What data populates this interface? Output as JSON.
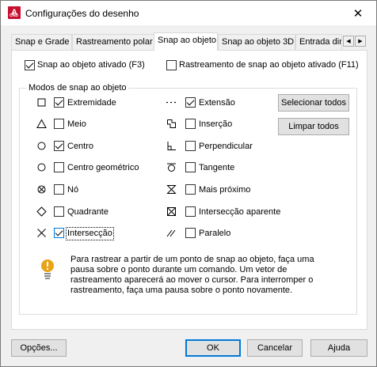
{
  "window": {
    "title": "Configurações do desenho",
    "app_icon_letter": "A",
    "app_icon_caption": "CAD",
    "close_glyph": "✕"
  },
  "tabs": [
    {
      "label": "Snap e Grade",
      "active": false
    },
    {
      "label": "Rastreamento polar",
      "active": false
    },
    {
      "label": "Snap ao objeto",
      "active": true
    },
    {
      "label": "Snap ao objeto 3D",
      "active": false
    },
    {
      "label": "Entrada din",
      "active": false
    }
  ],
  "tab_scroll": {
    "left_glyph": "◀",
    "right_glyph": "▶"
  },
  "top_options": {
    "snap_on": {
      "label": "Snap ao objeto ativado (F3)",
      "checked": true
    },
    "tracking_on": {
      "label": "Rastreamento de snap ao objeto ativado (F11)",
      "checked": false
    }
  },
  "modes_group": {
    "title": "Modos de snap ao objeto",
    "left": [
      {
        "icon": "endpoint-square-icon",
        "label": "Extremidade",
        "checked": true
      },
      {
        "icon": "midpoint-triangle-icon",
        "label": "Meio",
        "checked": false
      },
      {
        "icon": "center-circle-icon",
        "label": "Centro",
        "checked": true
      },
      {
        "icon": "geometric-center-icon",
        "label": "Centro geométrico",
        "checked": false
      },
      {
        "icon": "node-icon",
        "label": "Nó",
        "checked": false
      },
      {
        "icon": "quadrant-diamond-icon",
        "label": "Quadrante",
        "checked": false
      },
      {
        "icon": "intersection-x-icon",
        "label": "Intersecção",
        "checked": true
      }
    ],
    "right": [
      {
        "icon": "extension-icon",
        "label": "Extensão",
        "checked": true
      },
      {
        "icon": "insertion-icon",
        "label": "Inserção",
        "checked": false
      },
      {
        "icon": "perpendicular-icon",
        "label": "Perpendicular",
        "checked": false
      },
      {
        "icon": "tangent-icon",
        "label": "Tangente",
        "checked": false
      },
      {
        "icon": "nearest-hourglass-icon",
        "label": "Mais próximo",
        "checked": false
      },
      {
        "icon": "apparent-intersection-icon",
        "label": "Intersecção aparente",
        "checked": false
      },
      {
        "icon": "parallel-icon",
        "label": "Paralelo",
        "checked": false
      }
    ],
    "select_all_label": "Selecionar todos",
    "clear_all_label": "Limpar todos"
  },
  "info": {
    "icon": "lightbulb-icon",
    "text": "Para rastrear a partir de um ponto de snap ao objeto, faça uma pausa sobre o ponto durante um comando. Um vetor de rastreamento aparecerá ao mover o cursor. Para interromper o rastreamento, faça uma pausa sobre o ponto novamente."
  },
  "footer": {
    "options_label": "Opções...",
    "ok_label": "OK",
    "cancel_label": "Cancelar",
    "help_label": "Ajuda"
  },
  "colors": {
    "accent": "#0078d7",
    "app_icon_bg": "#c8102e",
    "info_icon": "#e8a317"
  }
}
